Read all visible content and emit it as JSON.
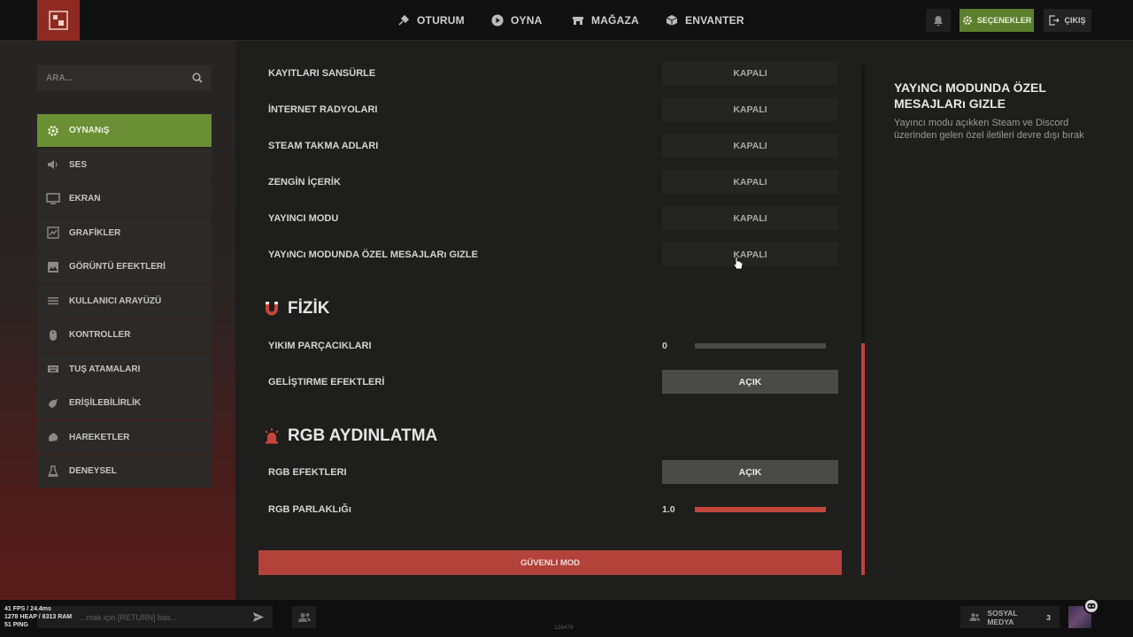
{
  "topbar": {
    "nav": [
      {
        "label": "OTURUM",
        "icon": "satellite-icon"
      },
      {
        "label": "OYNA",
        "icon": "play-icon"
      },
      {
        "label": "MAĞAZA",
        "icon": "store-icon"
      },
      {
        "label": "ENVANTER",
        "icon": "box-icon"
      }
    ],
    "options_label": "SEÇENEKLER",
    "exit_label": "ÇIKIŞ"
  },
  "sidebar": {
    "search_placeholder": "ARA...",
    "items": [
      {
        "label": "OYNANıŞ",
        "icon": "gear-icon",
        "active": true
      },
      {
        "label": "SES",
        "icon": "speaker-icon"
      },
      {
        "label": "EKRAN",
        "icon": "monitor-icon"
      },
      {
        "label": "GRAFİKLER",
        "icon": "graphics-icon"
      },
      {
        "label": "GÖRÜNTÜ EFEKTLERİ",
        "icon": "image-icon"
      },
      {
        "label": "KULLANICI ARAYÜZÜ",
        "icon": "menu-lines-icon"
      },
      {
        "label": "KONTROLLER",
        "icon": "mouse-icon"
      },
      {
        "label": "TUŞ ATAMALARI",
        "icon": "keyboard-icon"
      },
      {
        "label": "ERİŞİLEBİLİRLİK",
        "icon": "accessibility-icon"
      },
      {
        "label": "HAREKETLER",
        "icon": "gesture-icon"
      },
      {
        "label": "DENEYSEL",
        "icon": "flask-icon"
      }
    ]
  },
  "settings": {
    "privacy_rows": [
      {
        "label": "KAYITLARI SANSÜRLE",
        "value": "KAPALI"
      },
      {
        "label": "İNTERNET RADYOLARI",
        "value": "KAPALI"
      },
      {
        "label": "STEAM TAKMA ADLARI",
        "value": "KAPALI"
      },
      {
        "label": "ZENGİN İÇERİK",
        "value": "KAPALI"
      },
      {
        "label": "YAYINCI MODU",
        "value": "KAPALI"
      },
      {
        "label": "YAYıNCı MODUNDA ÖZEL MESAJLARı GIZLE",
        "value": "KAPALI"
      }
    ],
    "physics": {
      "title": "FİZİK",
      "debris": {
        "label": "YIKIM PARÇACIKLARI",
        "value": "0",
        "fraction": 0
      },
      "dev_effects": {
        "label": "GELİŞTIRME EFEKTLERİ",
        "value": "AÇIK"
      }
    },
    "rgb": {
      "title": "RGB AYDINLATMA",
      "effects": {
        "label": "RGB EFEKTLERI",
        "value": "AÇIK"
      },
      "brightness": {
        "label": "RGB PARLAKLıĞı",
        "value": "1.0",
        "fraction": 1.0
      }
    },
    "safe_mode_label": "GÜVENLI MOD"
  },
  "info": {
    "title": "YAYıNCı MODUNDA ÖZEL MESAJLARı GIZLE",
    "description": "Yayıncı modu açıkken Steam ve Discord üzerinden gelen özel iletileri devre dışı bırak"
  },
  "bottombar": {
    "fps": "41 FPS / 24.4ms",
    "memory": "1278 HEAP / 8313 RAM",
    "ping": "51 PING",
    "chat_placeholder": "...mak için [RETURN] bas...",
    "version": "128479",
    "social_label": "SOSYAL MEDYA",
    "social_count": "3"
  },
  "colors": {
    "accent_green": "#6b8f35",
    "accent_red": "#c2463b",
    "safe_mode_red": "#b2423a"
  }
}
